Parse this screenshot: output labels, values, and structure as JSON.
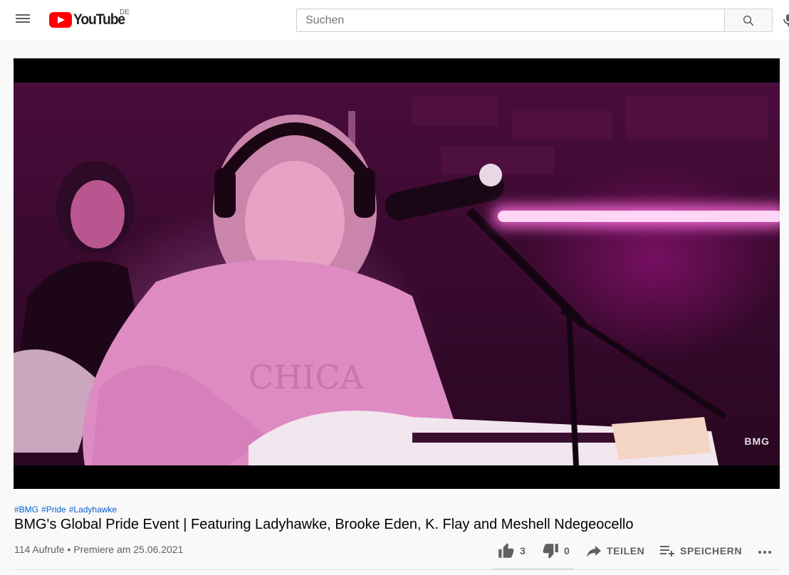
{
  "masthead": {
    "logo_text": "YouTube",
    "region": "DE",
    "search": {
      "placeholder": "Suchen",
      "value": ""
    },
    "icons": [
      "menu-icon",
      "search-icon",
      "microphone-icon"
    ]
  },
  "player": {
    "watermark": "BMG"
  },
  "video": {
    "hashtags": [
      "#BMG",
      "#Pride",
      "#Ladyhawke"
    ],
    "title": "BMG's Global Pride Event | Featuring Ladyhawke, Brooke Eden, K. Flay and Meshell Ndegeocello",
    "views_text": "114 Aufrufe • Premiere am 25.06.2021"
  },
  "actions": {
    "like_count": "3",
    "dislike_count": "0",
    "share_label": "TEILEN",
    "save_label": "SPEICHERN",
    "more_icon": "more-horizontal-icon"
  },
  "colors": {
    "brand_red": "#ff0000",
    "link_blue": "#065fd4",
    "text_secondary": "#606060"
  }
}
